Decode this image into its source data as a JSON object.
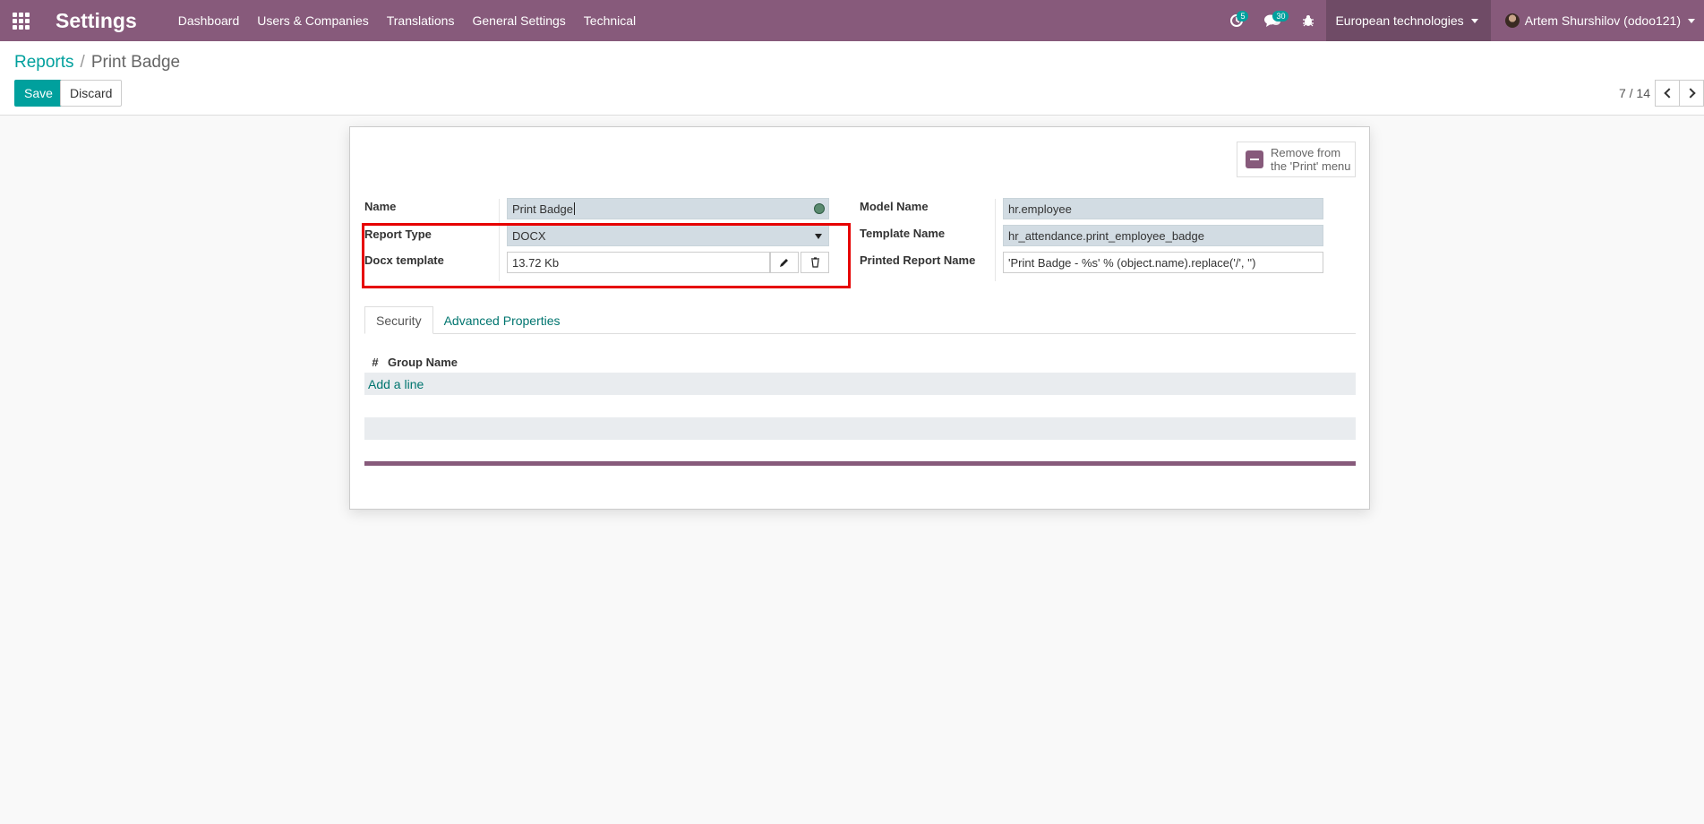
{
  "navbar": {
    "brand": "Settings",
    "menu": [
      "Dashboard",
      "Users & Companies",
      "Translations",
      "General Settings",
      "Technical"
    ],
    "activity_count": "5",
    "messages_count": "30",
    "company": "European technologies",
    "user": "Artem Shurshilov (odoo121)"
  },
  "breadcrumb": {
    "parent": "Reports",
    "separator": "/",
    "current": "Print Badge"
  },
  "actions": {
    "save": "Save",
    "discard": "Discard"
  },
  "pager": {
    "value": "7 / 14"
  },
  "form": {
    "remove_button": {
      "line1": "Remove from",
      "line2": "the 'Print' menu"
    },
    "name_label": "Name",
    "name_value": "Print Badge",
    "report_type_label": "Report Type",
    "report_type_value": "DOCX",
    "docx_template_label": "Docx template",
    "docx_template_value": "13.72 Kb",
    "model_name_label": "Model Name",
    "model_name_value": "hr.employee",
    "template_name_label": "Template Name",
    "template_name_value": "hr_attendance.print_employee_badge",
    "printed_report_name_label": "Printed Report Name",
    "printed_report_name_value": "'Print Badge - %s' % (object.name).replace('/', '')"
  },
  "tabs": [
    "Security",
    "Advanced Properties"
  ],
  "list": {
    "col_number": "#",
    "col_group": "Group Name",
    "add_line": "Add a line"
  },
  "colors": {
    "navbar": "#875a7b",
    "primary": "#00a09d",
    "highlight": "#e60000"
  }
}
